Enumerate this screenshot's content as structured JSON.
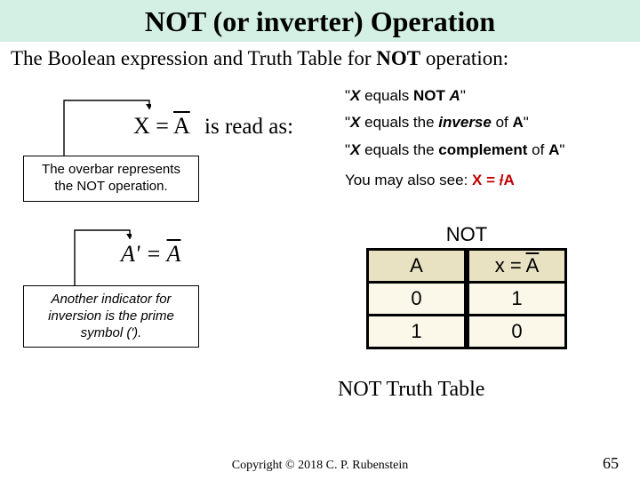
{
  "title": "NOT (or inverter) Operation",
  "subtitle_pre": "The Boolean expression and Truth Table for ",
  "subtitle_bold": "NOT",
  "subtitle_post": " operation:",
  "expr1": {
    "X": "X",
    "eq": " = ",
    "A": "A",
    "readas": "  is read as:"
  },
  "readings": {
    "l1_open": "\"",
    "l1_x": "X",
    "l1_mid": " equals ",
    "l1_not": "NOT ",
    "l1_a": "A",
    "l1_close": "\"",
    "l2_open": "\"",
    "l2_x": "X",
    "l2_mid": " equals the ",
    "l2_inv": "inverse",
    "l2_of": " of ",
    "l2_a": "A",
    "l2_close": "\"",
    "l3_open": "\"",
    "l3_x": "X",
    "l3_mid": " equals the ",
    "l3_comp": "complement",
    "l3_of": " of ",
    "l3_a": "A",
    "l3_close": "\"",
    "maysee_pre": "You may also see: ",
    "maysee_x": "X",
    "maysee_eq": " = ",
    "maysee_bar": "/",
    "maysee_a": "A"
  },
  "box1": "The overbar represents the NOT operation.",
  "expr2": {
    "Ap": "A'",
    "eq": " = ",
    "A": "A"
  },
  "box2": "Another indicator for inversion is the prime symbol (').",
  "table": {
    "not": "NOT",
    "hA": "A",
    "hX_pre": "x = ",
    "hX_A": "A",
    "r1c1": "0",
    "r1c2": "1",
    "r2c1": "1",
    "r2c2": "0",
    "caption": "NOT Truth Table"
  },
  "footer": {
    "copy": "Copyright © 2018 C. P. Rubenstein",
    "page": "65"
  },
  "chart_data": {
    "type": "table",
    "title": "NOT Truth Table",
    "columns": [
      "A",
      "x = Ā"
    ],
    "rows": [
      [
        0,
        1
      ],
      [
        1,
        0
      ]
    ]
  }
}
